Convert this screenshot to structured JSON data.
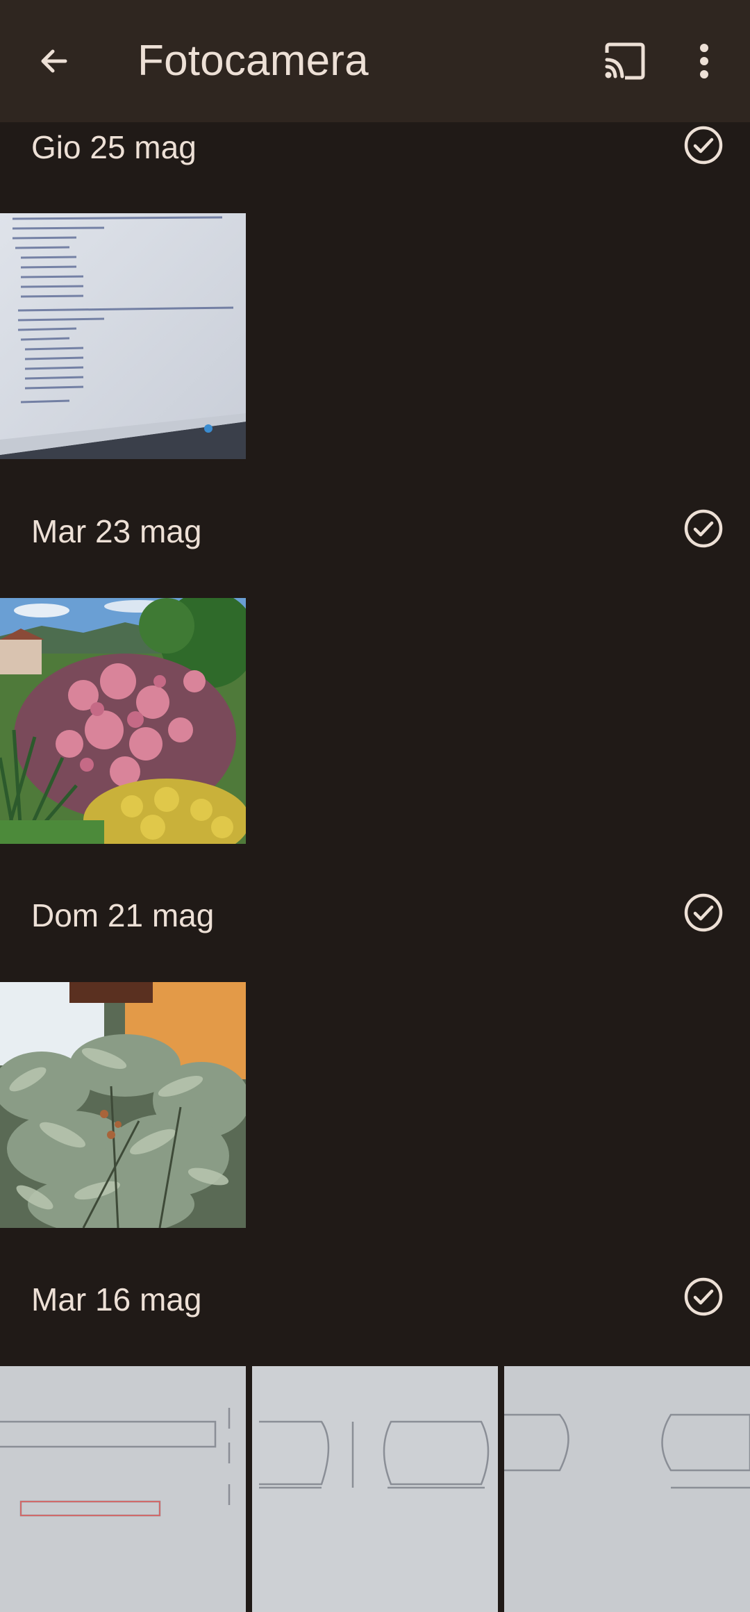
{
  "app_bar": {
    "title": "Fotocamera",
    "back_icon": "arrow-back-icon",
    "cast_icon": "cast-icon",
    "more_icon": "more-vert-icon"
  },
  "sections": [
    {
      "date": "Gio 25 mag",
      "select_icon": "check-circle-icon",
      "photos": [
        "photo-screen-doctor-schedule"
      ]
    },
    {
      "date": "Mar 23 mag",
      "select_icon": "check-circle-icon",
      "photos": [
        "photo-flowering-shrub-garden"
      ]
    },
    {
      "date": "Dom 21 mag",
      "select_icon": "check-circle-icon",
      "photos": [
        "photo-leafy-plant"
      ]
    },
    {
      "date": "Mar 16 mag",
      "select_icon": "check-circle-icon",
      "photos": [
        "photo-sketch-fianco",
        "photo-sketch-sopra-sotto",
        "photo-sketch-sotto"
      ]
    }
  ],
  "colors": {
    "background": "#201a17",
    "app_bar": "#2f2620",
    "text": "#ede0d6"
  }
}
